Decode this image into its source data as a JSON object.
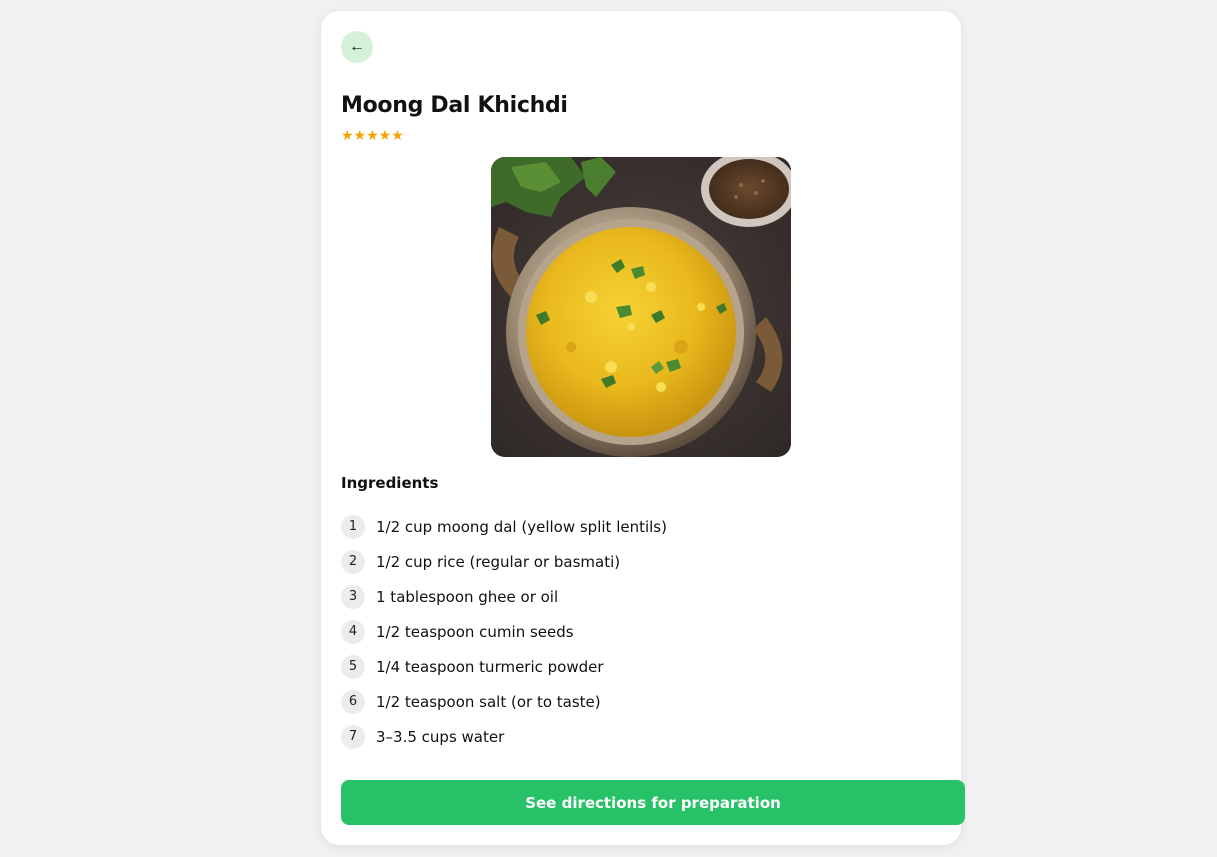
{
  "nav": {
    "back_label": "←"
  },
  "recipe": {
    "title": "Moong Dal Khichdi",
    "rating_stars": "★★★★★",
    "rating_value": 5,
    "image_alt": "Moong Dal Khichdi in a copper bowl"
  },
  "ingredients": {
    "heading": "Ingredients",
    "items": [
      {
        "num": "1",
        "text": "1/2 cup moong dal (yellow split lentils)"
      },
      {
        "num": "2",
        "text": "1/2 cup rice (regular or basmati)"
      },
      {
        "num": "3",
        "text": "1 tablespoon ghee or oil"
      },
      {
        "num": "4",
        "text": "1/2 teaspoon cumin seeds"
      },
      {
        "num": "5",
        "text": "1/4 teaspoon turmeric powder"
      },
      {
        "num": "6",
        "text": "1/2 teaspoon salt (or to taste)"
      },
      {
        "num": "7",
        "text": "3–3.5 cups water"
      }
    ]
  },
  "actions": {
    "directions_label": "See directions for preparation"
  },
  "colors": {
    "accent": "#27c267",
    "back_button_bg": "#d6f1d9",
    "star": "#f5a300",
    "page_bg": "#f1f1f1",
    "card_bg": "#ffffff"
  }
}
